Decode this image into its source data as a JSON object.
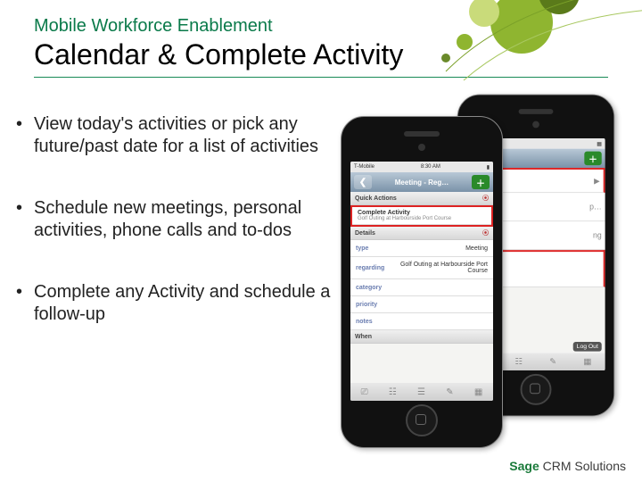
{
  "header": {
    "eyebrow": "Mobile Workforce Enablement",
    "title": "Calendar & Complete Activity"
  },
  "bullets": [
    "View today's activities or pick any future/past date for a list of activities",
    "Schedule new meetings, personal activities, phone calls and to-dos",
    "Complete any Activity and schedule a follow-up"
  ],
  "front_phone": {
    "carrier": "T-Mobile",
    "time": "8:30 AM",
    "nav_title": "Meeting - Reg…",
    "nav_left_glyph": "❮",
    "nav_right_glyph": "＋",
    "quick_hdr": "Quick Actions",
    "quick_action": "Complete Activity",
    "quick_sub": "Golf Outing at Harbourside Port Course",
    "details_hdr": "Details",
    "rows": [
      {
        "label": "type",
        "val": "Meeting"
      },
      {
        "label": "regarding",
        "val": "Golf Outing at Harbourside Port Course"
      },
      {
        "label": "category",
        "val": ""
      },
      {
        "label": "priority",
        "val": ""
      },
      {
        "label": "notes",
        "val": ""
      }
    ],
    "when_hdr": "When"
  },
  "back_phone": {
    "logout": "Log Out",
    "row_suffixes": [
      "",
      "p…",
      "ng",
      ""
    ]
  },
  "footer": {
    "brand": "Sage",
    "product": " CRM Solutions"
  }
}
